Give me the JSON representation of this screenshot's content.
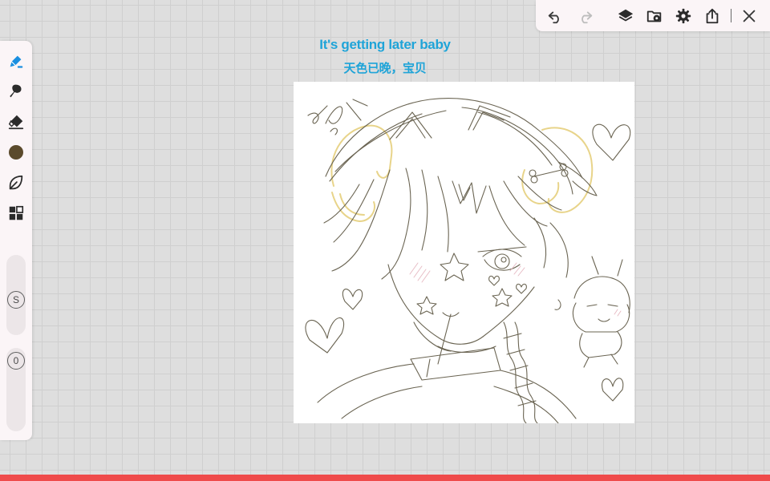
{
  "caption": {
    "line1": "It's getting later baby",
    "line2": "天色已晚，宝贝"
  },
  "toolbar": {
    "icons": [
      "undo-icon",
      "redo-icon",
      "layers-icon",
      "gallery-icon",
      "settings-icon",
      "share-icon",
      "close-icon"
    ]
  },
  "tools": {
    "icons": [
      "brush-icon",
      "smudge-icon",
      "eraser-icon",
      "color-swatch",
      "lasso-icon",
      "grid-icon"
    ],
    "current_color": "#5b4a2c",
    "accent_color": "#1a8fe0"
  },
  "sliders": {
    "size_label": "S",
    "opacity_label": "0"
  },
  "colors": {
    "background": "#dedede",
    "panel": "#fbf5f7",
    "sketch_line": "#6a6452",
    "highlight_yellow": "#e8d48a",
    "bottom_bar": "#ef4b4b"
  }
}
